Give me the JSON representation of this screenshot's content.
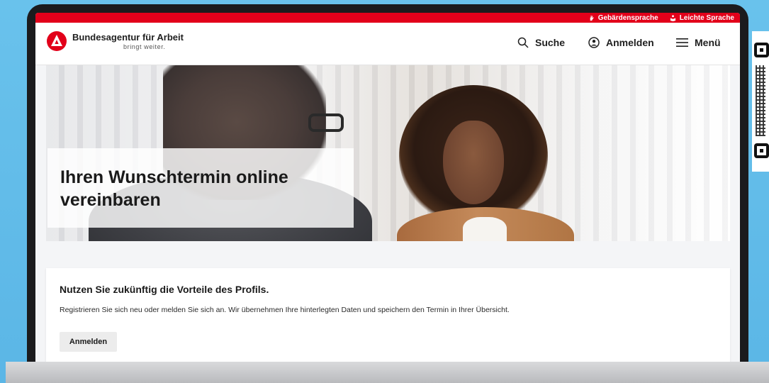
{
  "topbar": {
    "sign_language": "Gebärdensprache",
    "easy_language": "Leichte Sprache"
  },
  "header": {
    "logo_title": "Bundesagentur für Arbeit",
    "logo_subtitle": "bringt weiter.",
    "search_label": "Suche",
    "login_label": "Anmelden",
    "menu_label": "Menü"
  },
  "hero": {
    "title": "Ihren Wunschtermin online vereinbaren"
  },
  "profile_card": {
    "title": "Nutzen Sie zukünftig die Vorteile des Profils.",
    "text": "Registrieren Sie sich neu oder melden Sie sich an. Wir übernehmen Ihre hinterlegten Daten und speichern den Termin in Ihrer Übersicht.",
    "button_label": "Anmelden"
  },
  "colors": {
    "brand_red": "#e2001a",
    "background_blue": "#69c2ec"
  },
  "icons": {
    "sign_language": "hand-icon",
    "easy_language": "reading-person-icon",
    "search": "search-icon",
    "login": "user-circle-icon",
    "menu": "hamburger-icon",
    "logo": "ba-logo-icon"
  }
}
